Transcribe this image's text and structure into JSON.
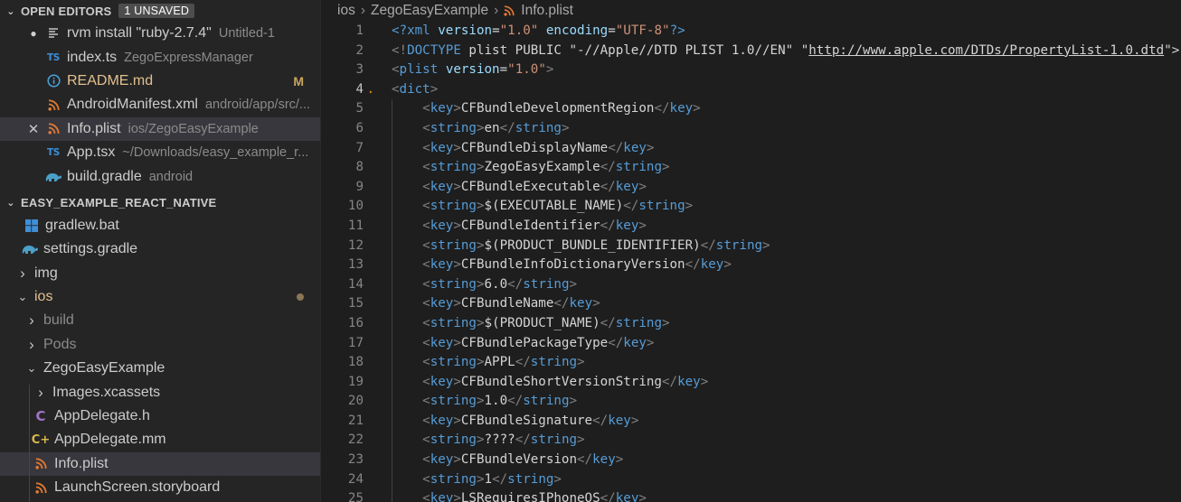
{
  "open_editors": {
    "title": "OPEN EDITORS",
    "badge": "1 UNSAVED",
    "items": [
      {
        "name": "rvm install \"ruby-2.7.4\"",
        "desc": "Untitled-1",
        "icon": "file-icon",
        "lead": "●"
      },
      {
        "name": "index.ts",
        "desc": "ZegoExpressManager",
        "icon": "ts-icon",
        "icon_text": "TS"
      },
      {
        "name": "README.md",
        "desc": "",
        "icon": "info-icon",
        "flag": "M"
      },
      {
        "name": "AndroidManifest.xml",
        "desc": "android/app/src/...",
        "icon": "rss-icon"
      },
      {
        "name": "Info.plist",
        "desc": "ios/ZegoEasyExample",
        "icon": "rss-icon",
        "lead": "✕"
      },
      {
        "name": "App.tsx",
        "desc": "~/Downloads/easy_example_r...",
        "icon": "ts-icon",
        "icon_text": "TS"
      },
      {
        "name": "build.gradle",
        "desc": "android",
        "icon": "gradle-icon"
      }
    ]
  },
  "explorer": {
    "title": "EASY_EXAMPLE_REACT_NATIVE",
    "items": [
      {
        "name": "gradlew.bat",
        "icon": "windows-icon"
      },
      {
        "name": "settings.gradle",
        "icon": "gradle-icon"
      },
      {
        "name": "img",
        "chevron": "›"
      },
      {
        "name": "ios",
        "chevron": "⌄"
      },
      {
        "name": "build",
        "chevron": "›"
      },
      {
        "name": "Pods",
        "chevron": "›"
      },
      {
        "name": "ZegoEasyExample",
        "chevron": "⌄"
      },
      {
        "name": "Images.xcassets",
        "chevron": "›"
      },
      {
        "name": "AppDelegate.h",
        "icon": "c-header-icon",
        "icon_text": "C"
      },
      {
        "name": "AppDelegate.mm",
        "icon": "cpp-icon",
        "icon_text": "C+"
      },
      {
        "name": "Info.plist",
        "icon": "rss-icon"
      },
      {
        "name": "LaunchScreen.storyboard",
        "icon": "rss-icon"
      }
    ]
  },
  "breadcrumb": [
    "ios",
    "ZegoEasyExample",
    "Info.plist"
  ],
  "editor": {
    "active_line": "4",
    "lines": [
      {
        "n": "1",
        "tokens": [
          [
            "pi",
            "<?"
          ],
          [
            "pi",
            "xml"
          ],
          [
            "txt",
            " "
          ],
          [
            "attr",
            "version"
          ],
          [
            "txt",
            "="
          ],
          [
            "str",
            "\"1.0\""
          ],
          [
            "txt",
            " "
          ],
          [
            "attr",
            "encoding"
          ],
          [
            "txt",
            "="
          ],
          [
            "str",
            "\"UTF-8\""
          ],
          [
            "pi",
            "?>"
          ]
        ]
      },
      {
        "n": "2",
        "tokens": [
          [
            "pun",
            "<!"
          ],
          [
            "tag",
            "DOCTYPE"
          ],
          [
            "txt",
            " plist PUBLIC \"-//Apple//DTD PLIST 1.0//EN\" \""
          ],
          [
            "link",
            "http://www.apple.com/DTDs/PropertyList-1.0.dtd"
          ],
          [
            "txt",
            "\">"
          ]
        ]
      },
      {
        "n": "3",
        "tokens": [
          [
            "pun",
            "<"
          ],
          [
            "tag",
            "plist"
          ],
          [
            "txt",
            " "
          ],
          [
            "attr",
            "version"
          ],
          [
            "txt",
            "="
          ],
          [
            "str",
            "\"1.0\""
          ],
          [
            "pun",
            ">"
          ]
        ]
      },
      {
        "n": "4",
        "tokens": [
          [
            "pun",
            "<"
          ],
          [
            "tag",
            "dict"
          ],
          [
            "pun",
            ">"
          ]
        ]
      },
      {
        "n": "5",
        "tokens": [
          [
            "txt",
            "    "
          ],
          [
            "pun",
            "<"
          ],
          [
            "tag",
            "key"
          ],
          [
            "pun",
            ">"
          ],
          [
            "txt",
            "CFBundleDevelopmentRegion"
          ],
          [
            "pun",
            "</"
          ],
          [
            "tag",
            "key"
          ],
          [
            "pun",
            ">"
          ]
        ]
      },
      {
        "n": "6",
        "tokens": [
          [
            "txt",
            "    "
          ],
          [
            "pun",
            "<"
          ],
          [
            "tag",
            "string"
          ],
          [
            "pun",
            ">"
          ],
          [
            "txt",
            "en"
          ],
          [
            "pun",
            "</"
          ],
          [
            "tag",
            "string"
          ],
          [
            "pun",
            ">"
          ]
        ]
      },
      {
        "n": "7",
        "tokens": [
          [
            "txt",
            "    "
          ],
          [
            "pun",
            "<"
          ],
          [
            "tag",
            "key"
          ],
          [
            "pun",
            ">"
          ],
          [
            "txt",
            "CFBundleDisplayName"
          ],
          [
            "pun",
            "</"
          ],
          [
            "tag",
            "key"
          ],
          [
            "pun",
            ">"
          ]
        ]
      },
      {
        "n": "8",
        "tokens": [
          [
            "txt",
            "    "
          ],
          [
            "pun",
            "<"
          ],
          [
            "tag",
            "string"
          ],
          [
            "pun",
            ">"
          ],
          [
            "txt",
            "ZegoEasyExample"
          ],
          [
            "pun",
            "</"
          ],
          [
            "tag",
            "string"
          ],
          [
            "pun",
            ">"
          ]
        ]
      },
      {
        "n": "9",
        "tokens": [
          [
            "txt",
            "    "
          ],
          [
            "pun",
            "<"
          ],
          [
            "tag",
            "key"
          ],
          [
            "pun",
            ">"
          ],
          [
            "txt",
            "CFBundleExecutable"
          ],
          [
            "pun",
            "</"
          ],
          [
            "tag",
            "key"
          ],
          [
            "pun",
            ">"
          ]
        ]
      },
      {
        "n": "10",
        "tokens": [
          [
            "txt",
            "    "
          ],
          [
            "pun",
            "<"
          ],
          [
            "tag",
            "string"
          ],
          [
            "pun",
            ">"
          ],
          [
            "txt",
            "$(EXECUTABLE_NAME)"
          ],
          [
            "pun",
            "</"
          ],
          [
            "tag",
            "string"
          ],
          [
            "pun",
            ">"
          ]
        ]
      },
      {
        "n": "11",
        "tokens": [
          [
            "txt",
            "    "
          ],
          [
            "pun",
            "<"
          ],
          [
            "tag",
            "key"
          ],
          [
            "pun",
            ">"
          ],
          [
            "txt",
            "CFBundleIdentifier"
          ],
          [
            "pun",
            "</"
          ],
          [
            "tag",
            "key"
          ],
          [
            "pun",
            ">"
          ]
        ]
      },
      {
        "n": "12",
        "tokens": [
          [
            "txt",
            "    "
          ],
          [
            "pun",
            "<"
          ],
          [
            "tag",
            "string"
          ],
          [
            "pun",
            ">"
          ],
          [
            "txt",
            "$(PRODUCT_BUNDLE_IDENTIFIER)"
          ],
          [
            "pun",
            "</"
          ],
          [
            "tag",
            "string"
          ],
          [
            "pun",
            ">"
          ]
        ]
      },
      {
        "n": "13",
        "tokens": [
          [
            "txt",
            "    "
          ],
          [
            "pun",
            "<"
          ],
          [
            "tag",
            "key"
          ],
          [
            "pun",
            ">"
          ],
          [
            "txt",
            "CFBundleInfoDictionaryVersion"
          ],
          [
            "pun",
            "</"
          ],
          [
            "tag",
            "key"
          ],
          [
            "pun",
            ">"
          ]
        ]
      },
      {
        "n": "14",
        "tokens": [
          [
            "txt",
            "    "
          ],
          [
            "pun",
            "<"
          ],
          [
            "tag",
            "string"
          ],
          [
            "pun",
            ">"
          ],
          [
            "txt",
            "6.0"
          ],
          [
            "pun",
            "</"
          ],
          [
            "tag",
            "string"
          ],
          [
            "pun",
            ">"
          ]
        ]
      },
      {
        "n": "15",
        "tokens": [
          [
            "txt",
            "    "
          ],
          [
            "pun",
            "<"
          ],
          [
            "tag",
            "key"
          ],
          [
            "pun",
            ">"
          ],
          [
            "txt",
            "CFBundleName"
          ],
          [
            "pun",
            "</"
          ],
          [
            "tag",
            "key"
          ],
          [
            "pun",
            ">"
          ]
        ]
      },
      {
        "n": "16",
        "tokens": [
          [
            "txt",
            "    "
          ],
          [
            "pun",
            "<"
          ],
          [
            "tag",
            "string"
          ],
          [
            "pun",
            ">"
          ],
          [
            "txt",
            "$(PRODUCT_NAME)"
          ],
          [
            "pun",
            "</"
          ],
          [
            "tag",
            "string"
          ],
          [
            "pun",
            ">"
          ]
        ]
      },
      {
        "n": "17",
        "tokens": [
          [
            "txt",
            "    "
          ],
          [
            "pun",
            "<"
          ],
          [
            "tag",
            "key"
          ],
          [
            "pun",
            ">"
          ],
          [
            "txt",
            "CFBundlePackageType"
          ],
          [
            "pun",
            "</"
          ],
          [
            "tag",
            "key"
          ],
          [
            "pun",
            ">"
          ]
        ]
      },
      {
        "n": "18",
        "tokens": [
          [
            "txt",
            "    "
          ],
          [
            "pun",
            "<"
          ],
          [
            "tag",
            "string"
          ],
          [
            "pun",
            ">"
          ],
          [
            "txt",
            "APPL"
          ],
          [
            "pun",
            "</"
          ],
          [
            "tag",
            "string"
          ],
          [
            "pun",
            ">"
          ]
        ]
      },
      {
        "n": "19",
        "tokens": [
          [
            "txt",
            "    "
          ],
          [
            "pun",
            "<"
          ],
          [
            "tag",
            "key"
          ],
          [
            "pun",
            ">"
          ],
          [
            "txt",
            "CFBundleShortVersionString"
          ],
          [
            "pun",
            "</"
          ],
          [
            "tag",
            "key"
          ],
          [
            "pun",
            ">"
          ]
        ]
      },
      {
        "n": "20",
        "tokens": [
          [
            "txt",
            "    "
          ],
          [
            "pun",
            "<"
          ],
          [
            "tag",
            "string"
          ],
          [
            "pun",
            ">"
          ],
          [
            "txt",
            "1.0"
          ],
          [
            "pun",
            "</"
          ],
          [
            "tag",
            "string"
          ],
          [
            "pun",
            ">"
          ]
        ]
      },
      {
        "n": "21",
        "tokens": [
          [
            "txt",
            "    "
          ],
          [
            "pun",
            "<"
          ],
          [
            "tag",
            "key"
          ],
          [
            "pun",
            ">"
          ],
          [
            "txt",
            "CFBundleSignature"
          ],
          [
            "pun",
            "</"
          ],
          [
            "tag",
            "key"
          ],
          [
            "pun",
            ">"
          ]
        ]
      },
      {
        "n": "22",
        "tokens": [
          [
            "txt",
            "    "
          ],
          [
            "pun",
            "<"
          ],
          [
            "tag",
            "string"
          ],
          [
            "pun",
            ">"
          ],
          [
            "txt",
            "????"
          ],
          [
            "pun",
            "</"
          ],
          [
            "tag",
            "string"
          ],
          [
            "pun",
            ">"
          ]
        ]
      },
      {
        "n": "23",
        "tokens": [
          [
            "txt",
            "    "
          ],
          [
            "pun",
            "<"
          ],
          [
            "tag",
            "key"
          ],
          [
            "pun",
            ">"
          ],
          [
            "txt",
            "CFBundleVersion"
          ],
          [
            "pun",
            "</"
          ],
          [
            "tag",
            "key"
          ],
          [
            "pun",
            ">"
          ]
        ]
      },
      {
        "n": "24",
        "tokens": [
          [
            "txt",
            "    "
          ],
          [
            "pun",
            "<"
          ],
          [
            "tag",
            "string"
          ],
          [
            "pun",
            ">"
          ],
          [
            "txt",
            "1"
          ],
          [
            "pun",
            "</"
          ],
          [
            "tag",
            "string"
          ],
          [
            "pun",
            ">"
          ]
        ]
      },
      {
        "n": "25",
        "tokens": [
          [
            "txt",
            "    "
          ],
          [
            "pun",
            "<"
          ],
          [
            "tag",
            "key"
          ],
          [
            "pun",
            ">"
          ],
          [
            "txt",
            "LSRequiresIPhoneOS"
          ],
          [
            "pun",
            "</"
          ],
          [
            "tag",
            "key"
          ],
          [
            "pun",
            ">"
          ]
        ]
      }
    ]
  },
  "colors": {
    "sidebar_bg": "#252526",
    "editor_bg": "#1e1e1e",
    "selection": "#37373d",
    "modified": "#e2c08d",
    "tag": "#569cd6",
    "attribute": "#9cdcfe",
    "string": "#ce9178"
  }
}
